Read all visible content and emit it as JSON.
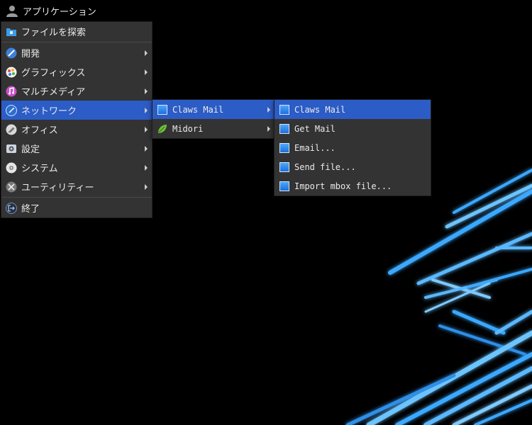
{
  "topbar": {
    "title": "アプリケーション",
    "icon": "user-icon"
  },
  "main_menu": {
    "items": [
      {
        "label": "ファイルを探索",
        "icon": "folder-icon",
        "submenu": false
      },
      {
        "label": "開発",
        "icon": "development-icon",
        "submenu": true
      },
      {
        "label": "グラフィックス",
        "icon": "graphics-icon",
        "submenu": true
      },
      {
        "label": "マルチメディア",
        "icon": "multimedia-icon",
        "submenu": true
      },
      {
        "label": "ネットワーク",
        "icon": "network-icon",
        "submenu": true,
        "active": true
      },
      {
        "label": "オフィス",
        "icon": "office-icon",
        "submenu": true
      },
      {
        "label": "設定",
        "icon": "settings-icon",
        "submenu": true
      },
      {
        "label": "システム",
        "icon": "system-icon",
        "submenu": true
      },
      {
        "label": "ユーティリティー",
        "icon": "utilities-icon",
        "submenu": true
      },
      {
        "label": "終了",
        "icon": "logout-icon",
        "submenu": false
      }
    ]
  },
  "network_menu": {
    "items": [
      {
        "label": "Claws Mail",
        "icon": "claws-mail-icon",
        "submenu": true,
        "active": true
      },
      {
        "label": "Midori",
        "icon": "midori-icon",
        "submenu": true
      }
    ]
  },
  "claws_menu": {
    "items": [
      {
        "label": "Claws Mail",
        "icon": "claws-mail-icon",
        "active": true
      },
      {
        "label": "Get Mail",
        "icon": "claws-mail-icon"
      },
      {
        "label": "Email...",
        "icon": "claws-mail-icon"
      },
      {
        "label": "Send file...",
        "icon": "claws-mail-icon"
      },
      {
        "label": "Import mbox file...",
        "icon": "claws-mail-icon"
      }
    ]
  },
  "colors": {
    "highlight": "#2c5cc6",
    "menu_bg": "#333333",
    "desktop_bg": "#000000",
    "glow": "#39a6ff"
  }
}
